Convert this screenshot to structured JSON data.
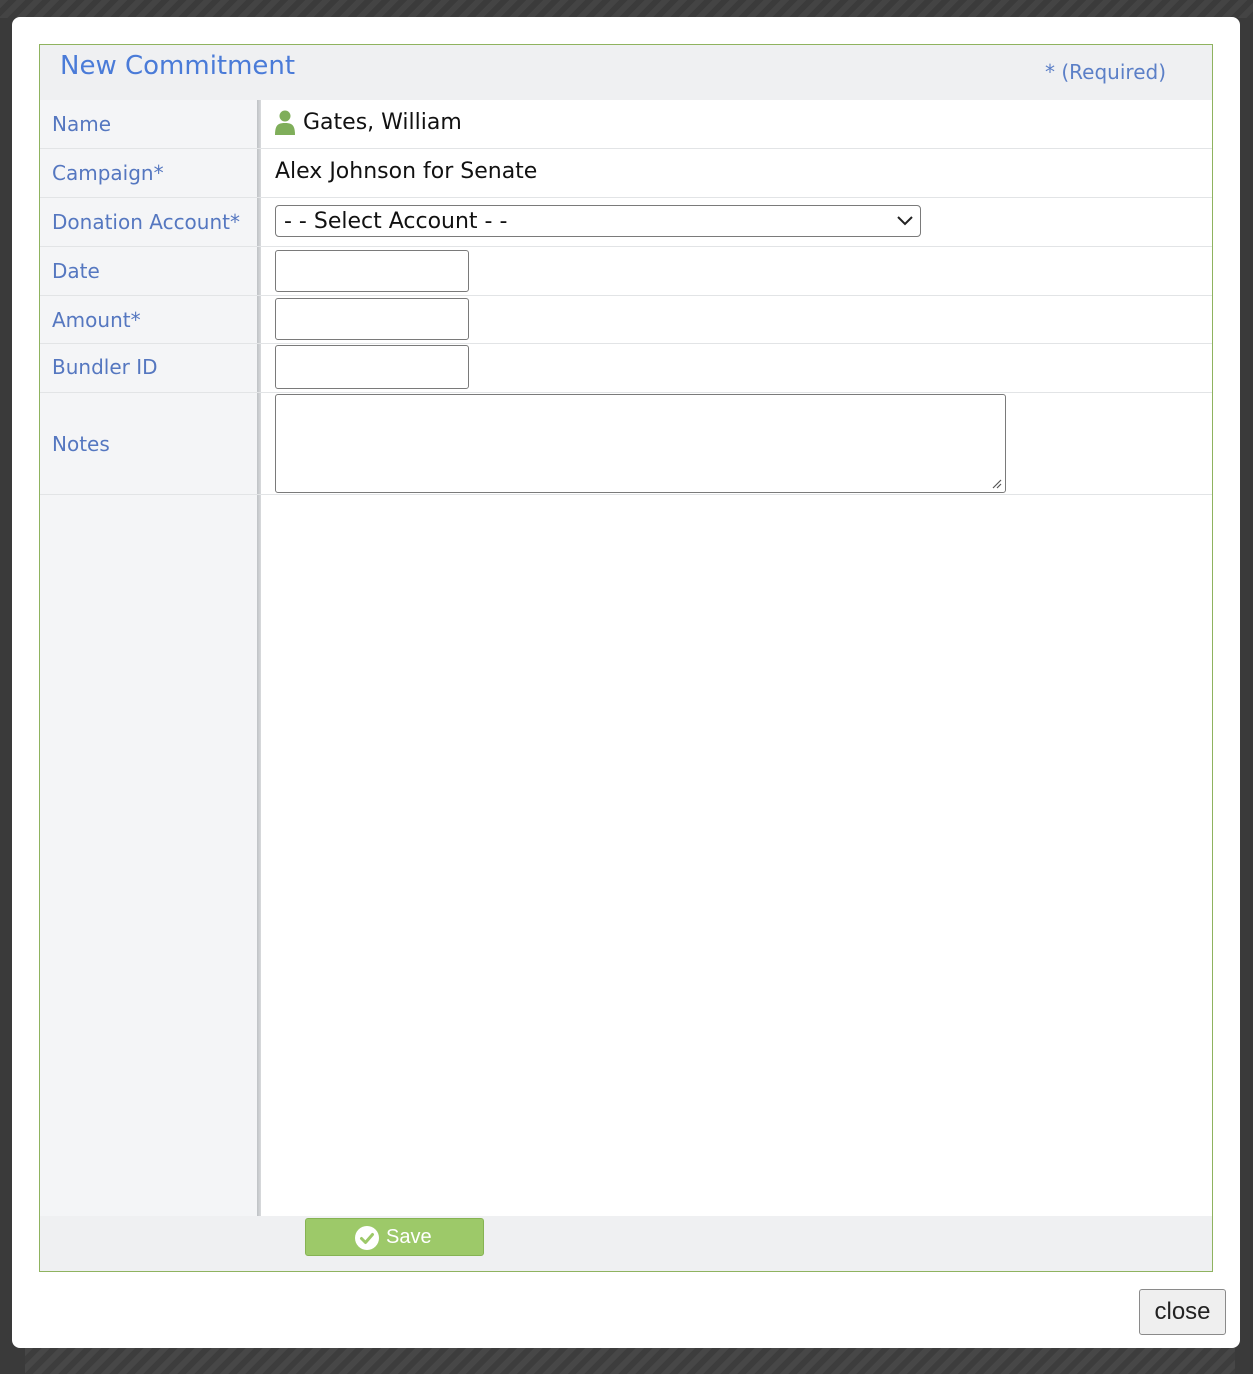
{
  "dialog": {
    "title": "New Commitment",
    "required_note": "* (Required)",
    "close_label": "close"
  },
  "form": {
    "name": {
      "label": "Name",
      "value": "Gates, William",
      "icon": "person-icon"
    },
    "campaign": {
      "label": "Campaign*",
      "value": "Alex Johnson for Senate"
    },
    "donation_account": {
      "label": "Donation Account*",
      "selected": "- - Select Account - -"
    },
    "date": {
      "label": "Date",
      "value": ""
    },
    "amount": {
      "label": "Amount*",
      "value": ""
    },
    "bundler_id": {
      "label": "Bundler ID",
      "value": ""
    },
    "notes": {
      "label": "Notes",
      "value": ""
    }
  },
  "footer": {
    "save_label": "Save",
    "save_icon": "check-circle-icon"
  },
  "colors": {
    "accent_blue": "#4a7bd8",
    "label_blue": "#5577c0",
    "save_green": "#9dc969",
    "panel_border": "#8fb35f",
    "person_icon": "#7fae5a"
  }
}
